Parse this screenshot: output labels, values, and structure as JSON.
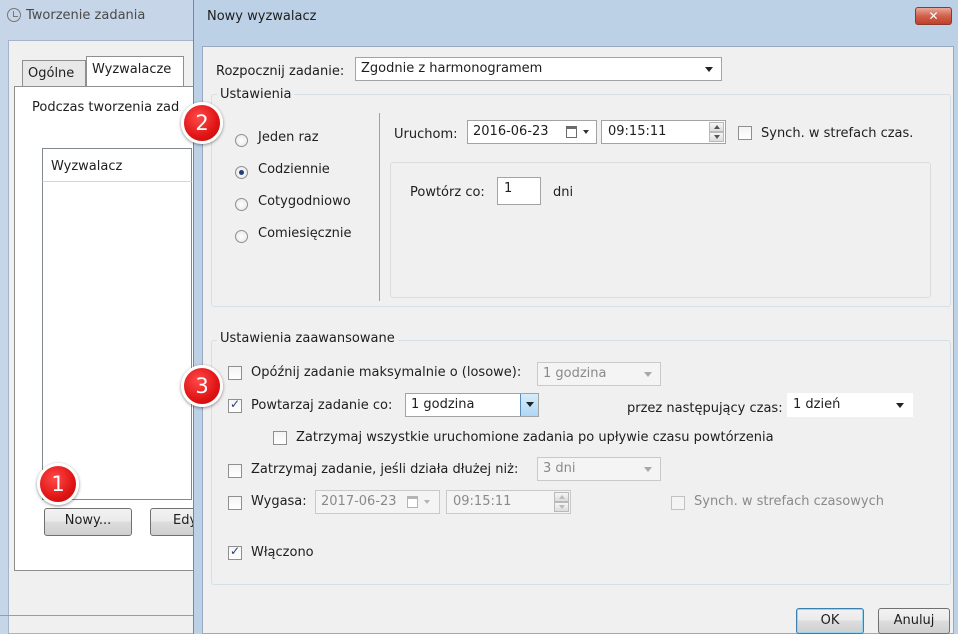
{
  "background_window": {
    "title": "Tworzenie zadania",
    "tabs": [
      {
        "label": "Ogólne"
      },
      {
        "label": "Wyzwalacze"
      }
    ],
    "description": "Podczas tworzenia zad",
    "list_header": "Wyzwalacz",
    "buttons": {
      "new": "Nowy...",
      "edit": "Edy"
    }
  },
  "dialog": {
    "title": "Nowy wyzwalacz",
    "close_glyph": "✕",
    "start_task": {
      "label": "Rozpocznij zadanie:",
      "value": "Zgodnie z harmonogramem"
    },
    "settings": {
      "group_title": "Ustawienia",
      "radios": [
        {
          "label": "Jeden raz",
          "checked": false
        },
        {
          "label": "Codziennie",
          "checked": true
        },
        {
          "label": "Cotygodniowo",
          "checked": false
        },
        {
          "label": "Comiesięcznie",
          "checked": false
        }
      ],
      "start": {
        "label": "Uruchom:",
        "date": "2016-06-23",
        "time": "09:15:11"
      },
      "sync_timezones": {
        "label": "Synch. w strefach czas.",
        "checked": false
      },
      "repeat_every": {
        "label": "Powtórz co:",
        "value": "1",
        "unit": "dni"
      }
    },
    "advanced": {
      "group_title": "Ustawienia zaawansowane",
      "delay": {
        "label": "Opóźnij zadanie maksymalnie o (losowe):",
        "value": "1 godzina",
        "checked": false
      },
      "repeat": {
        "label": "Powtarzaj zadanie co:",
        "value": "1 godzina",
        "checked": true
      },
      "duration": {
        "label": "przez następujący czas:",
        "value": "1 dzień"
      },
      "stop_all": {
        "label": "Zatrzymaj wszystkie uruchomione zadania po upływie czasu powtórzenia",
        "checked": false
      },
      "stop_if_longer": {
        "label": "Zatrzymaj zadanie, jeśli działa dłużej niż:",
        "value": "3 dni",
        "checked": false
      },
      "expire": {
        "label": "Wygasa:",
        "date": "2017-06-23",
        "time": "09:15:11",
        "checked": false
      },
      "expire_sync": {
        "label": "Synch. w strefach czasowych",
        "checked": false
      },
      "enabled": {
        "label": "Włączono",
        "checked": true
      }
    },
    "buttons": {
      "ok": "OK",
      "cancel": "Anuluj"
    }
  },
  "badges": [
    "1",
    "2",
    "3"
  ]
}
